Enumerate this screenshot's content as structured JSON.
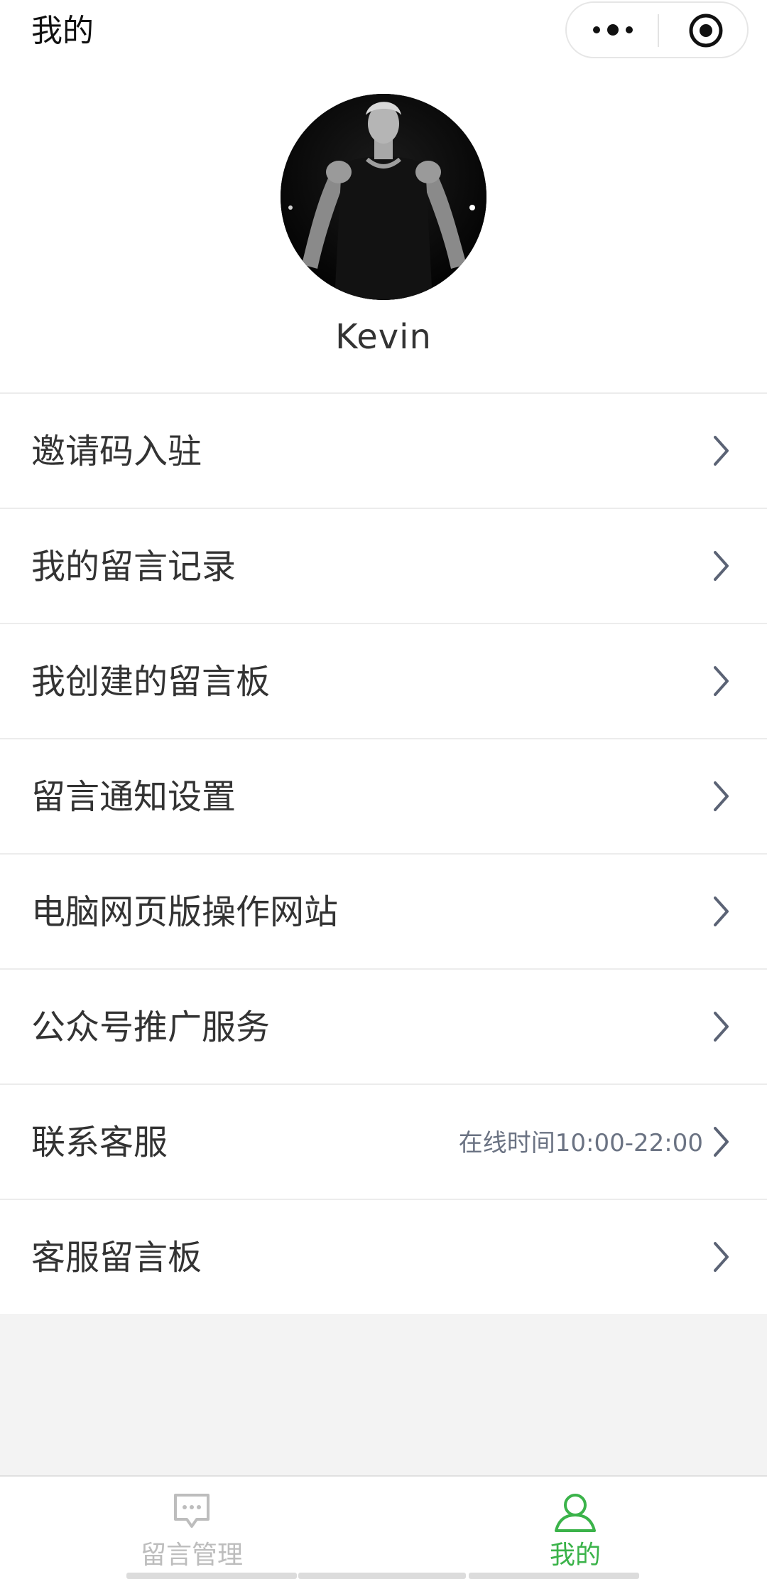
{
  "nav": {
    "title": "我的"
  },
  "profile": {
    "username": "Kevin"
  },
  "menu": {
    "items": [
      {
        "label": "邀请码入驻"
      },
      {
        "label": "我的留言记录"
      },
      {
        "label": "我创建的留言板"
      },
      {
        "label": "留言通知设置"
      },
      {
        "label": "电脑网页版操作网站"
      },
      {
        "label": "公众号推广服务"
      },
      {
        "label": "联系客服",
        "sub": "在线时间10:00-22:00"
      },
      {
        "label": "客服留言板"
      }
    ]
  },
  "tabbar": {
    "tabs": [
      {
        "label": "留言管理",
        "icon": "chat-bubble-icon",
        "active": false
      },
      {
        "label": "我的",
        "icon": "user-icon",
        "active": true
      }
    ]
  },
  "colors": {
    "accent": "#3bb34a",
    "inactive": "#bdbdbd",
    "chevron": "#5b6375",
    "subtext": "#6b7383"
  }
}
